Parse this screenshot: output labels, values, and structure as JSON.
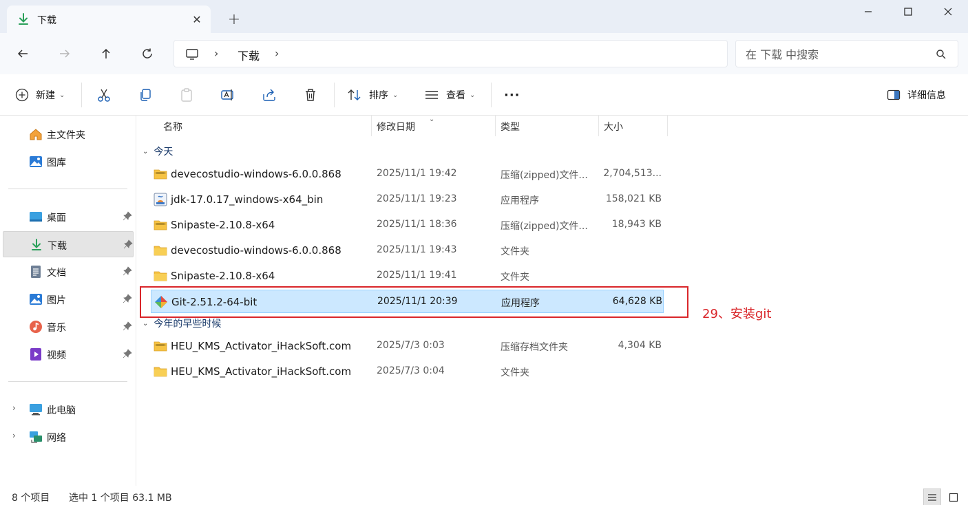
{
  "tab": {
    "title": "下载",
    "close": "✕",
    "new": "+"
  },
  "address": {
    "separator": "›",
    "crumb": "下载"
  },
  "search": {
    "placeholder": "在 下载 中搜索"
  },
  "toolbar": {
    "new_label": "新建",
    "sort_label": "排序",
    "view_label": "查看",
    "more_label": "···",
    "details_label": "详细信息"
  },
  "sidebar": {
    "home": "主文件夹",
    "gallery": "图库",
    "desktop": "桌面",
    "downloads": "下载",
    "documents": "文档",
    "pictures": "图片",
    "music": "音乐",
    "videos": "视频",
    "this_pc": "此电脑",
    "network": "网络",
    "expander": "›"
  },
  "columns": {
    "name": "名称",
    "date": "修改日期",
    "type": "类型",
    "size": "大小"
  },
  "groups": {
    "today": "今天",
    "earlier_this_year": "今年的早些时候"
  },
  "files_today": [
    {
      "name": "devecostudio-windows-6.0.0.868",
      "date": "2025/11/1 19:42",
      "type": "压缩(zipped)文件...",
      "size": "2,704,513...",
      "icon": "zip-folder-icon"
    },
    {
      "name": "jdk-17.0.17_windows-x64_bin",
      "date": "2025/11/1 19:23",
      "type": "应用程序",
      "size": "158,021 KB",
      "icon": "installer-icon"
    },
    {
      "name": "Snipaste-2.10.8-x64",
      "date": "2025/11/1 18:36",
      "type": "压缩(zipped)文件...",
      "size": "18,943 KB",
      "icon": "zip-folder-icon"
    },
    {
      "name": "devecostudio-windows-6.0.0.868",
      "date": "2025/11/1 19:43",
      "type": "文件夹",
      "size": "",
      "icon": "folder-icon"
    },
    {
      "name": "Snipaste-2.10.8-x64",
      "date": "2025/11/1 19:41",
      "type": "文件夹",
      "size": "",
      "icon": "folder-icon"
    },
    {
      "name": "Git-2.51.2-64-bit",
      "date": "2025/11/1 20:39",
      "type": "应用程序",
      "size": "64,628 KB",
      "icon": "git-icon",
      "selected": true
    }
  ],
  "files_earlier": [
    {
      "name": "HEU_KMS_Activator_iHackSoft.com",
      "date": "2025/7/3 0:03",
      "type": "压缩存档文件夹",
      "size": "4,304 KB",
      "icon": "zip-folder-icon"
    },
    {
      "name": "HEU_KMS_Activator_iHackSoft.com",
      "date": "2025/7/3 0:04",
      "type": "文件夹",
      "size": "",
      "icon": "folder-icon"
    }
  ],
  "annotation": {
    "text": "29、安装git",
    "color": "#d9262a"
  },
  "status": {
    "item_count": "8 个项目",
    "selection": "选中 1 个项目  63.1 MB"
  },
  "colors": {
    "accent": "#0067c0",
    "selection": "#cce8ff",
    "folder": "#f6c343"
  }
}
